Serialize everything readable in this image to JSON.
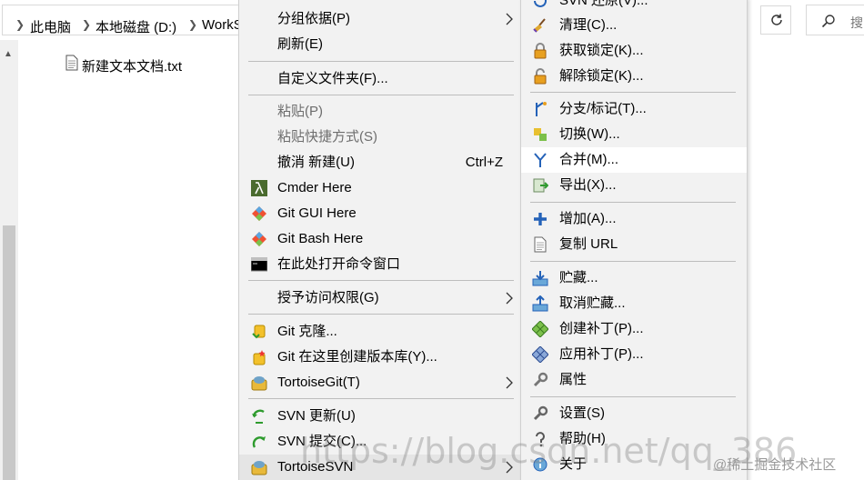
{
  "explorer": {
    "breadcrumbs": [
      "此电脑",
      "本地磁盘 (D:)",
      "WorkS"
    ],
    "search_placeholder": "搜",
    "file_name": "新建文本文档.txt"
  },
  "context_menu": {
    "items": [
      {
        "label": "分组依据(P)"
      },
      {
        "label": "刷新(E)"
      },
      {
        "label": "自定义文件夹(F)..."
      },
      {
        "label": "粘贴(P)"
      },
      {
        "label": "粘贴快捷方式(S)"
      },
      {
        "label": "撤消 新建(U)",
        "shortcut": "Ctrl+Z"
      },
      {
        "label": "Cmder Here"
      },
      {
        "label": "Git GUI Here"
      },
      {
        "label": "Git Bash Here"
      },
      {
        "label": "在此处打开命令窗口"
      },
      {
        "label": "授予访问权限(G)"
      },
      {
        "label": "Git 克隆..."
      },
      {
        "label": "Git 在这里创建版本库(Y)..."
      },
      {
        "label": "TortoiseGit(T)"
      },
      {
        "label": "SVN 更新(U)"
      },
      {
        "label": "SVN 提交(C)..."
      },
      {
        "label": "TortoiseSVN"
      }
    ]
  },
  "svn_submenu": {
    "items": [
      {
        "label": "SVN 还原(V)..."
      },
      {
        "label": "清理(C)..."
      },
      {
        "label": "获取锁定(K)..."
      },
      {
        "label": "解除锁定(K)..."
      },
      {
        "label": "分支/标记(T)..."
      },
      {
        "label": "切换(W)..."
      },
      {
        "label": "合并(M)..."
      },
      {
        "label": "导出(X)..."
      },
      {
        "label": "增加(A)..."
      },
      {
        "label": "复制 URL"
      },
      {
        "label": "贮藏..."
      },
      {
        "label": "取消贮藏..."
      },
      {
        "label": "创建补丁(P)..."
      },
      {
        "label": "应用补丁(P)..."
      },
      {
        "label": "属性"
      },
      {
        "label": "设置(S)"
      },
      {
        "label": "帮助(H)"
      },
      {
        "label": "关于"
      }
    ]
  },
  "watermarks": {
    "url": "https://blog.csdn.net/qq_386",
    "site": "@稀土掘金技术社区"
  }
}
